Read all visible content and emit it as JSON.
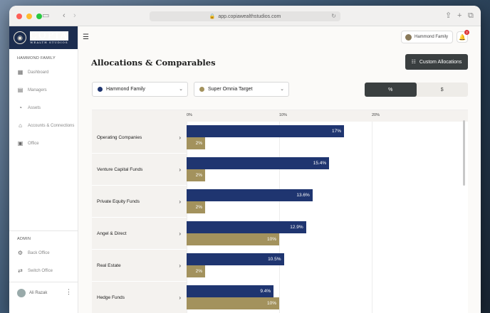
{
  "browser": {
    "url": "app.copiawealthstudios.com"
  },
  "brand": {
    "logo_main": "COPIA",
    "logo_sub": "WEALTH STUDIOS"
  },
  "sidebar": {
    "family_title": "HAMMOND FAMILY",
    "items": [
      {
        "label": "Dashboard",
        "icon": "dashboard-icon"
      },
      {
        "label": "Managers",
        "icon": "managers-icon"
      },
      {
        "label": "Assets",
        "icon": "pie-icon"
      },
      {
        "label": "Accounts & Connections",
        "icon": "bank-icon"
      },
      {
        "label": "Office",
        "icon": "briefcase-icon"
      }
    ],
    "admin_title": "ADMIN",
    "admin_items": [
      {
        "label": "Back Office",
        "icon": "gear-icon"
      },
      {
        "label": "Switch Office",
        "icon": "switch-icon"
      }
    ],
    "user_name": "Ali Razak"
  },
  "header": {
    "account_label": "Hammond Family",
    "notification_count": "2"
  },
  "page": {
    "title": "Allocations & Comparables",
    "custom_button": "Custom Allocations",
    "select_primary": "Hammond Family",
    "select_secondary": "Super Omnia Target",
    "toggle_percent": "%",
    "toggle_dollar": "$"
  },
  "colors": {
    "primary_series": "#1f3570",
    "secondary_series": "#a3925d",
    "dark_button": "#3a3f40"
  },
  "chart_data": {
    "type": "bar",
    "orientation": "horizontal",
    "ticks": [
      "0%",
      "10%",
      "20%"
    ],
    "xlim": [
      0,
      30
    ],
    "categories": [
      "Operating Companies",
      "Venture Capital Funds",
      "Private Equity Funds",
      "Angel & Direct",
      "Real Estate",
      "Hedge Funds"
    ],
    "series": [
      {
        "name": "Hammond Family",
        "values": [
          17,
          15.4,
          13.6,
          12.9,
          10.5,
          9.4
        ],
        "labels": [
          "17%",
          "15.4%",
          "13.6%",
          "12.9%",
          "10.5%",
          "9.4%"
        ]
      },
      {
        "name": "Super Omnia Target",
        "values": [
          2,
          2,
          2,
          10,
          2,
          10
        ],
        "labels": [
          "2%",
          "2%",
          "2%",
          "10%",
          "2%",
          "10%"
        ]
      }
    ]
  }
}
